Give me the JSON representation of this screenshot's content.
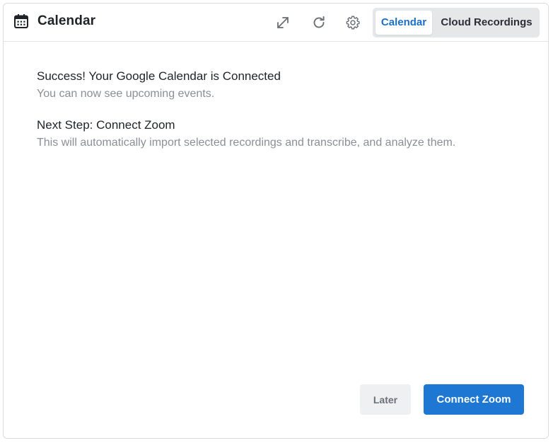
{
  "header": {
    "title": "Calendar",
    "title_icon": "calendar-icon",
    "actions": [
      {
        "name": "expand",
        "icon": "expand-icon"
      },
      {
        "name": "refresh",
        "icon": "refresh-icon"
      },
      {
        "name": "settings",
        "icon": "gear-icon"
      }
    ],
    "view_toggle": {
      "options": [
        "Calendar",
        "Cloud Recordings"
      ],
      "selected": "Calendar"
    }
  },
  "main": {
    "success_heading": "Success! Your Google Calendar is Connected",
    "success_sub": "You can now see upcoming events.",
    "next_heading": "Next Step: Connect Zoom",
    "next_sub": "This will automatically import selected recordings and transcribe, and analyze them."
  },
  "footer": {
    "later_label": "Later",
    "connect_label": "Connect Zoom"
  },
  "colors": {
    "accent": "#1f77d4",
    "active_tab_text": "#1c6fc9",
    "heading_text": "#1f2328",
    "muted_text": "#8a8f96"
  }
}
